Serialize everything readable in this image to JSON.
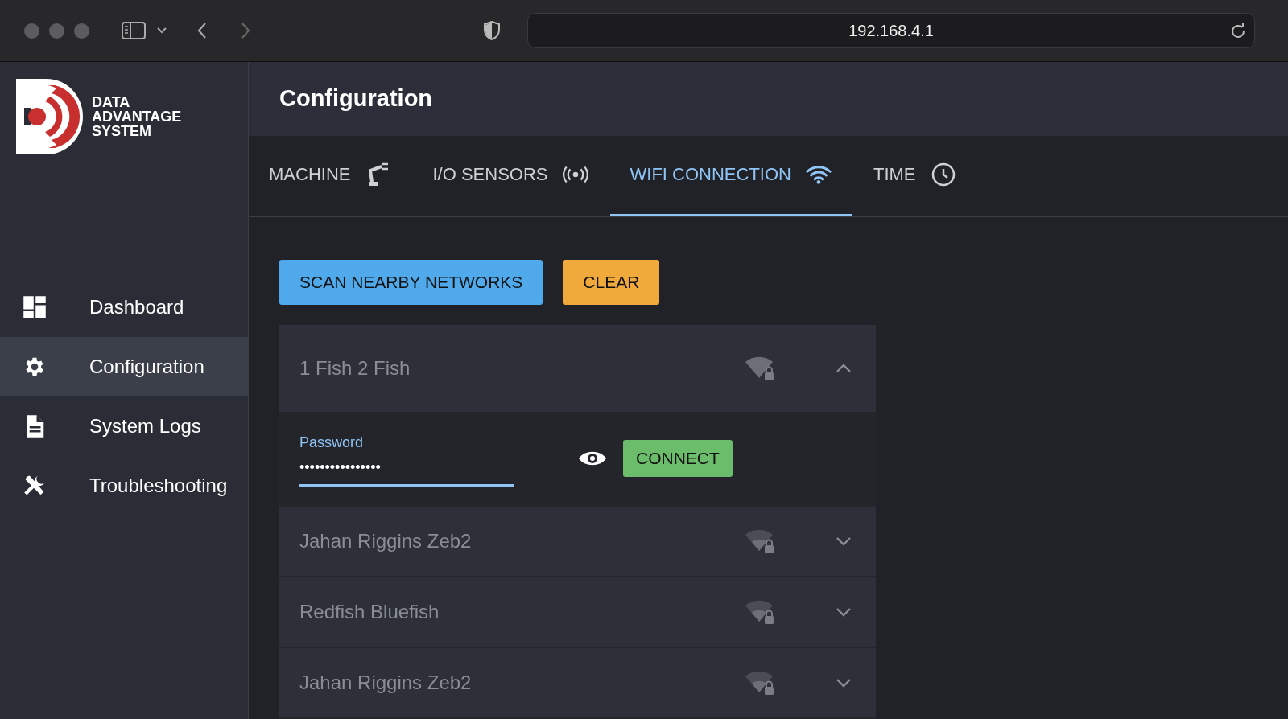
{
  "browser": {
    "address": "192.168.4.1"
  },
  "logo": {
    "lines": [
      "DATA",
      "ADVANTAGE",
      "SYSTEM"
    ]
  },
  "sidebar": {
    "items": [
      {
        "label": "Dashboard",
        "kind": "dashboard",
        "selected": false
      },
      {
        "label": "Configuration",
        "kind": "gear",
        "selected": true
      },
      {
        "label": "System Logs",
        "kind": "document",
        "selected": false
      },
      {
        "label": "Troubleshooting",
        "kind": "tools",
        "selected": false
      }
    ]
  },
  "header": {
    "title": "Configuration"
  },
  "tabs": [
    {
      "label": "MACHINE",
      "kind": "robot",
      "selected": false
    },
    {
      "label": "I/O SENSORS",
      "kind": "sensor",
      "selected": false
    },
    {
      "label": "WIFI CONNECTION",
      "kind": "wifi",
      "selected": true
    },
    {
      "label": "TIME",
      "kind": "clock",
      "selected": false
    }
  ],
  "buttons": {
    "scan": "SCAN NEARBY NETWORKS",
    "clear": "CLEAR"
  },
  "networks": [
    {
      "name": "1 Fish 2 Fish",
      "expanded": true,
      "password": {
        "label": "Password",
        "value": "••••••••••••••••"
      },
      "connect": "CONNECT"
    },
    {
      "name": "Jahan Riggins Zeb2",
      "expanded": false
    },
    {
      "name": "Redfish Bluefish",
      "expanded": false
    },
    {
      "name": "Jahan Riggins Zeb2",
      "expanded": false
    }
  ]
}
